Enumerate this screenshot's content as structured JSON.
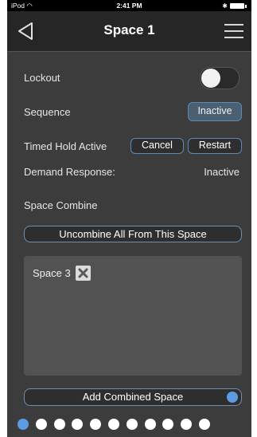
{
  "status_bar": {
    "carrier": "iPod",
    "time": "2:41 PM"
  },
  "nav": {
    "title": "Space 1"
  },
  "lockout": {
    "label": "Lockout",
    "enabled": false
  },
  "sequence": {
    "label": "Sequence",
    "value": "Inactive"
  },
  "timed_hold": {
    "label": "Timed Hold Active",
    "cancel_label": "Cancel",
    "restart_label": "Restart"
  },
  "demand_response": {
    "label": "Demand Response:",
    "value": "Inactive"
  },
  "space_combine": {
    "label": "Space Combine",
    "uncombine_label": "Uncombine All From This Space",
    "combined_spaces": [
      "Space 3"
    ]
  },
  "add_combined_label": "Add Combined Space",
  "pagination": {
    "total": 11,
    "active_index": 0
  },
  "colors": {
    "accent": "#5b9be3",
    "background": "#3c3c3c",
    "nav_bar": "#262626"
  },
  "icons": [
    "wifi-icon",
    "bluetooth-icon",
    "battery-icon",
    "back-arrow-icon",
    "menu-icon",
    "close-icon",
    "dropdown-arrow-icon"
  ]
}
